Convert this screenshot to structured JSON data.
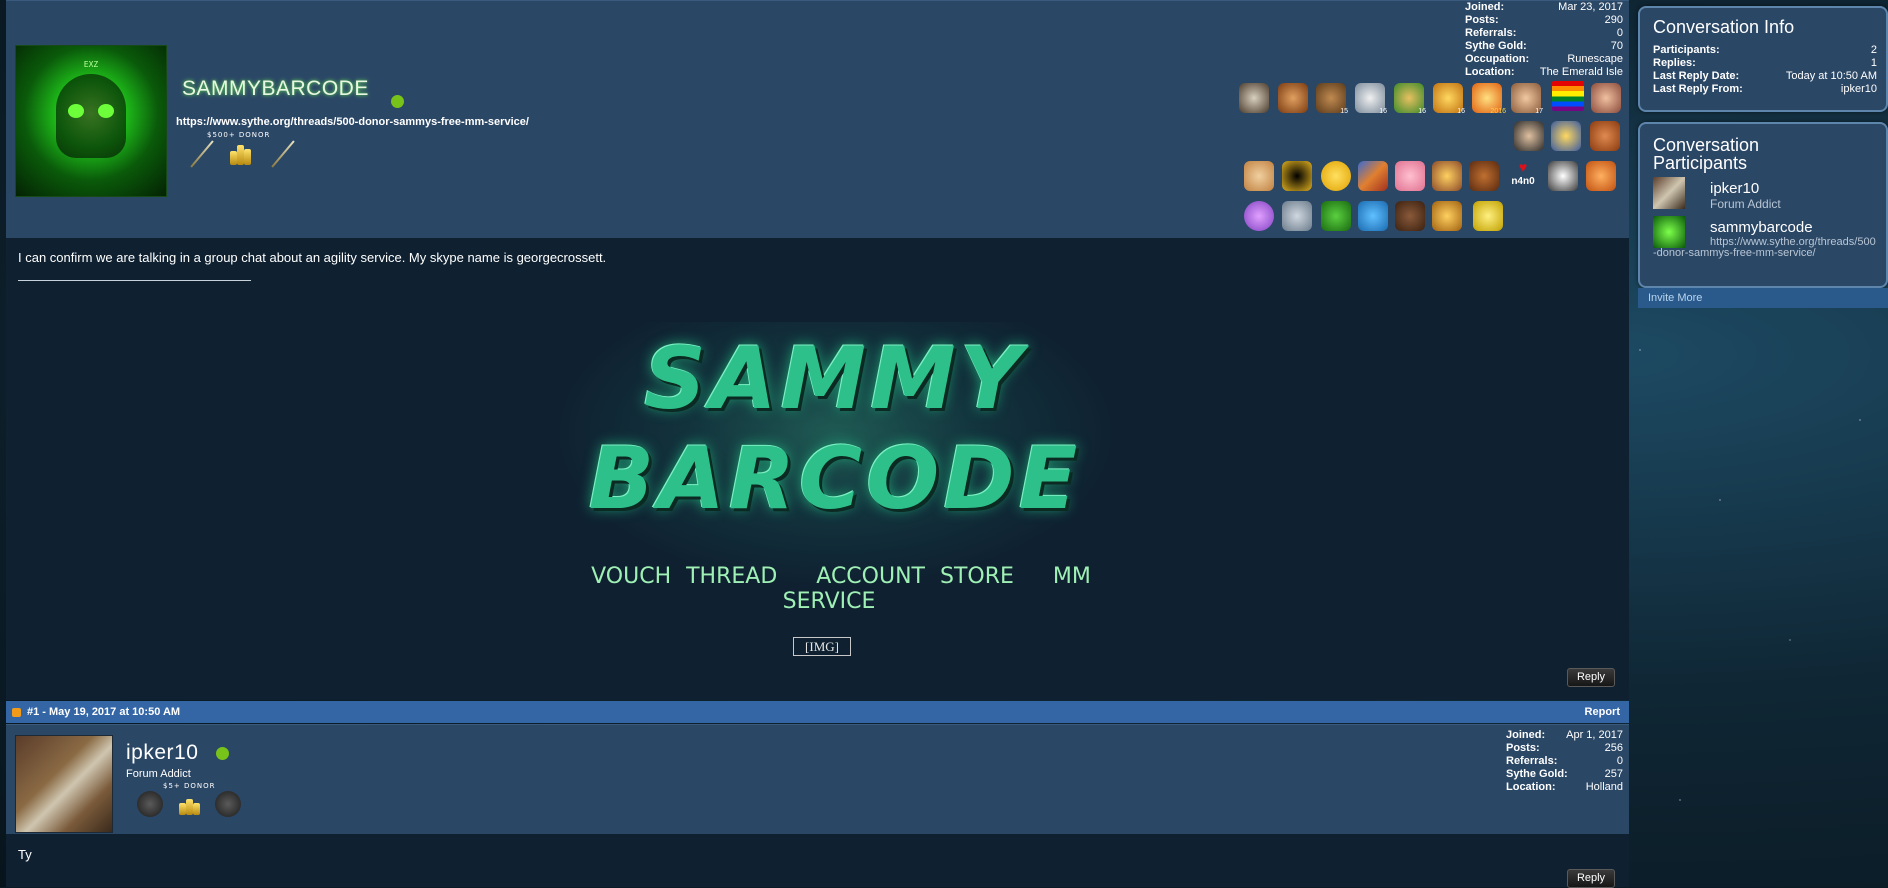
{
  "post1": {
    "username": "SAMMYBARCODE",
    "signature_link": "https://www.sythe.org/threads/500-donor-sammys-free-mm-service/",
    "donor_badge": "$500+ DONOR",
    "stats": [
      {
        "key": "Joined:",
        "value": "Mar 23, 2017"
      },
      {
        "key": "Posts:",
        "value": "290"
      },
      {
        "key": "Referrals:",
        "value": "0"
      },
      {
        "key": "Sythe Gold:",
        "value": "70"
      },
      {
        "key": "Occupation:",
        "value": "Runescape"
      },
      {
        "key": "Location:",
        "value": "The Emerald Isle"
      }
    ],
    "trophy_labels": [
      "15",
      "16",
      "16",
      "16",
      "2016",
      "17",
      "n4n0"
    ],
    "message": "I can confirm we are talking in a group chat about an agility service. My skype name is georgecrossett.",
    "banner": {
      "line1": "SAMMY",
      "line2": "BARCODE",
      "links": [
        "VOUCH THREAD",
        "ACCOUNT STORE",
        "MM SERVICE"
      ]
    },
    "broken_image": "[IMG]",
    "reply_label": "Reply"
  },
  "postbar": {
    "label": "#1 - May 19, 2017 at 10:50 AM",
    "report_label": "Report"
  },
  "post2": {
    "username": "ipker10",
    "title": "Forum Addict",
    "donor_badge": "$5+ DONOR",
    "stats": [
      {
        "key": "Joined:",
        "value": "Apr 1, 2017"
      },
      {
        "key": "Posts:",
        "value": "256"
      },
      {
        "key": "Referrals:",
        "value": "0"
      },
      {
        "key": "Sythe Gold:",
        "value": "257"
      },
      {
        "key": "Location:",
        "value": "Holland"
      }
    ],
    "message": "Ty",
    "reply_label": "Reply"
  },
  "sidebar": {
    "info_title": "Conversation Info",
    "info_rows": [
      {
        "key": "Participants:",
        "value": "2"
      },
      {
        "key": "Replies:",
        "value": "1"
      },
      {
        "key": "Last Reply Date:",
        "value": "Today at 10:50 AM"
      },
      {
        "key": "Last Reply From:",
        "value": "ipker10"
      }
    ],
    "participants_title": "Conversation Participants",
    "participants": [
      {
        "name": "ipker10",
        "subtitle": "Forum Addict"
      },
      {
        "name": "sammybarcode",
        "subtitle": "https://www.sythe.org/threads/500-donor-sammys-free-mm-service/"
      }
    ],
    "invite_label": "Invite More"
  },
  "colors": {
    "header_bg": "#2b4766",
    "body_bg": "#0f2131",
    "postbar_bg": "#3466a6",
    "online": "#77c31a",
    "sidebar_border": "#5e85ab"
  }
}
